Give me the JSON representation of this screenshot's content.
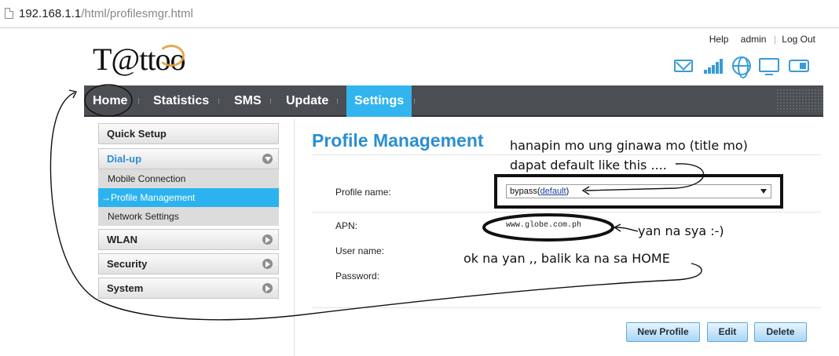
{
  "browser": {
    "url_host": "192.168.1.1",
    "url_path": "/html/profilesmgr.html"
  },
  "header": {
    "logo_text": "T@ttoo",
    "links": {
      "help": "Help",
      "user": "admin",
      "logout": "Log Out"
    },
    "status_icons": [
      "mail-icon",
      "signal-icon",
      "globe-icon",
      "monitor-icon",
      "battery-icon"
    ]
  },
  "nav": {
    "items": [
      "Home",
      "Statistics",
      "SMS",
      "Update",
      "Settings"
    ],
    "active": "Settings",
    "active_color": "#32b4ef"
  },
  "sidebar": {
    "quick_setup": "Quick Setup",
    "dialup": "Dial-up",
    "dialup_items": [
      "Mobile Connection",
      "→Profile Management",
      "Network Settings"
    ],
    "wlan": "WLAN",
    "security": "Security",
    "system": "System"
  },
  "main": {
    "title": "Profile Management",
    "profile_label": "Profile name:",
    "profile_value": "bypass(",
    "profile_value_default": "default",
    "profile_value_close": ")",
    "apn_label": "APN:",
    "apn_value": "www.globe.com.ph",
    "username_label": "User name:",
    "password_label": "Password:",
    "buttons": {
      "new": "New Profile",
      "edit": "Edit",
      "delete": "Delete"
    }
  },
  "annotations": {
    "line1": "hanapin mo ung ginawa mo (title mo)",
    "line2": "dapat default like this ....",
    "line3": "yan na sya :-)",
    "line4": "ok na yan ,, balik ka na sa HOME"
  }
}
